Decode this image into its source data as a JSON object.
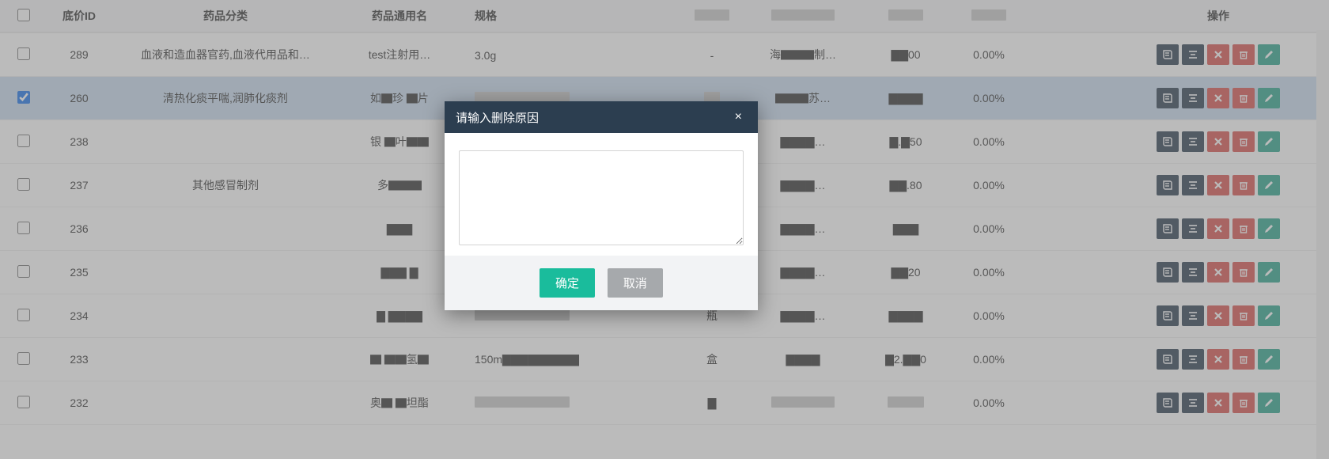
{
  "columns": {
    "id": "底价ID",
    "category": "药品分类",
    "generic": "药品通用名",
    "spec": "规格",
    "unit": "",
    "manu": "",
    "price": "",
    "pct": "",
    "extra": "",
    "ops": "操作"
  },
  "rows": [
    {
      "id": "289",
      "checked": false,
      "category": "血液和造血器官药,血液代用品和…",
      "generic": "test注射用…",
      "spec": "3.0g",
      "unit": "-",
      "manu": "海▇▇▇制…",
      "price": "▇▇00",
      "pct": "0.00%"
    },
    {
      "id": "260",
      "checked": true,
      "category": "清热化痰平喘,润肺化痰剂",
      "generic": "如▇珍 ▇片",
      "spec": "",
      "unit": "",
      "manu": "▇▇▇苏…",
      "price": "▇▇▇▇",
      "pct": "0.00%"
    },
    {
      "id": "238",
      "checked": false,
      "category": "",
      "generic": "银 ▇叶▇▇",
      "spec": "",
      "unit": "",
      "manu": "▇▇▇▇…",
      "price": "▇.▇50",
      "pct": "0.00%"
    },
    {
      "id": "237",
      "checked": false,
      "category": "其他感冒制剂",
      "generic": "多▇▇▇",
      "spec": "",
      "unit": "",
      "manu": "▇▇▇▇…",
      "price": "▇▇.80",
      "pct": "0.00%"
    },
    {
      "id": "236",
      "checked": false,
      "category": "",
      "generic": "▇▇▇",
      "spec": "",
      "unit": "",
      "manu": "▇▇▇▇…",
      "price": "▇▇▇",
      "pct": "0.00%"
    },
    {
      "id": "235",
      "checked": false,
      "category": "",
      "generic": "▇▇▇ ▇",
      "spec": "",
      "unit": "",
      "manu": "▇▇▇▇…",
      "price": "▇▇20",
      "pct": "0.00%"
    },
    {
      "id": "234",
      "checked": false,
      "category": "",
      "generic": "▇ ▇▇▇▇",
      "spec": "",
      "unit": "瓶",
      "manu": "▇▇▇▇…",
      "price": "▇▇▇▇",
      "pct": "0.00%"
    },
    {
      "id": "233",
      "checked": false,
      "category": "",
      "generic": "▇ ▇▇氢▇",
      "spec": "150m▇▇▇▇▇▇▇▇▇",
      "unit": "盒",
      "manu": "▇▇▇▇",
      "price": "▇2.▇▇0",
      "pct": "0.00%"
    },
    {
      "id": "232",
      "checked": false,
      "category": "",
      "generic": "奥▇ ▇坦酯",
      "spec": "",
      "unit": "▇",
      "manu": "",
      "price": "",
      "pct": "0.00%"
    }
  ],
  "modal": {
    "title": "请输入删除原因",
    "close": "×",
    "value": "",
    "confirm": "确定",
    "cancel": "取消"
  }
}
